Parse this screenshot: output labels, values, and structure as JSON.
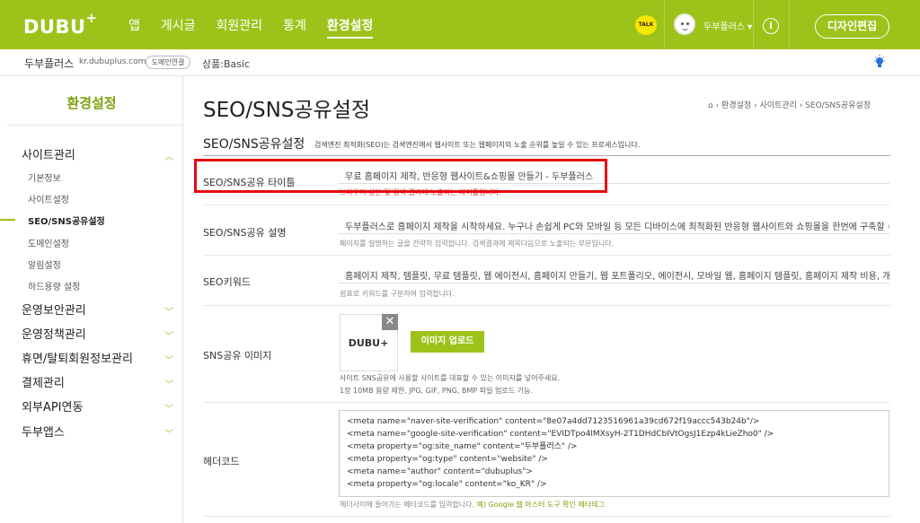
{
  "top": {
    "logo": "DUBU",
    "logo_plus": "+",
    "menu": [
      "앱",
      "게시글",
      "회원관리",
      "통계",
      "환경설정"
    ],
    "talk": "TALK",
    "user": "두부플러스 ▾",
    "info": "i",
    "design_button": "디자인편집"
  },
  "sub": {
    "site_name": "두부플러스",
    "domain": "kr.dubuplus.com",
    "domain_button": "도메인연결",
    "product": "상품:Basic"
  },
  "sidebar": {
    "title": "환경설정",
    "groups": [
      {
        "label": "사이트관리",
        "chevron": "^"
      },
      {
        "label": "운영보안관리",
        "chevron": "v"
      },
      {
        "label": "운영정책관리",
        "chevron": "v"
      },
      {
        "label": "휴면/탈퇴회원정보관리",
        "chevron": "v"
      },
      {
        "label": "결제관리",
        "chevron": "v"
      },
      {
        "label": "외부API연동",
        "chevron": "v"
      },
      {
        "label": "두부앱스",
        "chevron": "v"
      }
    ],
    "sub_items": [
      "기본정보",
      "사이트설정",
      "SEO/SNS공유설정",
      "도메인설정",
      "알림설정",
      "하드용량 설정"
    ]
  },
  "main": {
    "title": "SEO/SNS공유설정",
    "breadcrumb": "⌂  ›  환경설정  ›  사이트관리  ›  SEO/SNS공유설정",
    "section_title": "SEO/SNS공유설정",
    "section_desc": "검색엔진 최적화(SEO)는 검색엔진에서 웹사이트 또는 웹페이지의 노출 순위를 높일 수 있는 프로세스입니다.",
    "rows": {
      "title_label": "SEO/SNS공유 타이틀",
      "title_value": "무료 홈페이지 제작, 반응형 웹사이트&쇼핑몰 만들기 - 두부플러스",
      "title_help": "브라우저 상단 및 검색 결과에 노출되는 타이틀입니다.",
      "desc_label": "SEO/SNS공유 설명",
      "desc_value": "두부플러스로 홈페이지 제작을 시작하세요. 누구나 손쉽게 PC와 모바일 등 모든 디바이스에 최적화된 반응형 웹사이트와 쇼핑몰을 한번에 구축할 수 있습니다.",
      "desc_help": "페이지를 설명하는 글을 간략히 입력합니다. 검색결과에 제목다음으로 노출되는 부분입니다.",
      "kw_label": "SEO키워드",
      "kw_value": "홈페이지 제작, 템플릿, 무료 템플릿, 웹 에이전시, 홈페이지 만들기, 웹 포트폴리오, 에이전시, 모바일 웹, 홈페이지 템플릿, 홈페이지 제작 비용, 개인 홈페이지",
      "kw_help": "쉼표로 키워드를 구분하여 입력합니다.",
      "img_label": "SNS공유 이미지",
      "img_logo": "DUBU+",
      "img_close": "✕",
      "upload_button": "이미지 업로드",
      "img_help1": "사이트 SNS공유에 사용할 사이트를 대표할 수 있는 이미지를 넣어주세요.",
      "img_help2": "1장 10MB 용량 제한, JPG, GIF, PNG, BMP 파일 업로드 가능.",
      "header_label": "헤더코드",
      "header_lines": [
        "<meta name=\"naver-site-verification\" content=\"8e07a4dd7123516961a39cd672f19accc543b24b\"/>",
        "<meta name=\"google-site-verification\" content=\"EVIDTpo4lMXsyH-2T1DHdCbIVtOgsJ1Ezp4kLieZho0\" />",
        "<meta property=\"og:site_name\" content=\"두부플러스\" />",
        "<meta property=\"og:type\" content=\"website\" />",
        "<meta name=\"author\" content=\"dubuplus\">",
        "<meta property=\"og:locale\" content=\"ko_KR\" />"
      ],
      "header_help": "헤더사이에 들어가는 메타코드를 입력합니다. ",
      "header_help_link": "예) Google 웹 마스터 도구 확인 메타태그"
    }
  },
  "colors": {
    "brand": "#9dc31b",
    "highlight": "#e8090f"
  }
}
